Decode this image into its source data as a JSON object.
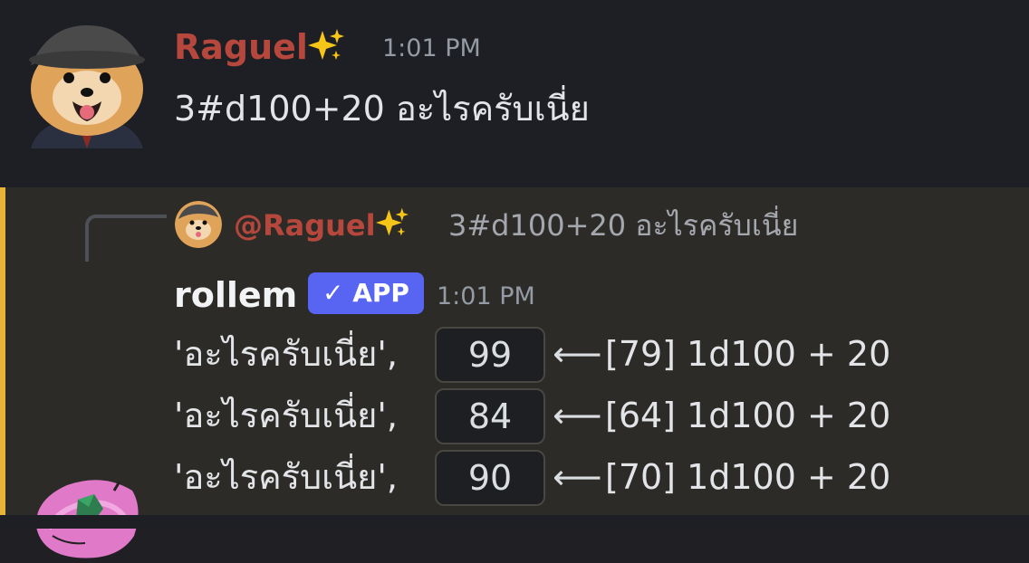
{
  "message1": {
    "author": "Raguel",
    "time": "1:01 PM",
    "content": "3#d100+20 อะไรครับเนี่ย",
    "name_color": "#b5473c"
  },
  "message2": {
    "reply": {
      "mention": "@Raguel",
      "text": "3#d100+20 อะไรครับเนี่ย"
    },
    "author": "rollem",
    "badge": "✓ APP",
    "time": "1:01 PM",
    "accent_color": "#e8b437",
    "rolls": [
      {
        "label": "'อะไรครับเนี่ย',",
        "result": "99",
        "arrow": "⟵",
        "detail": "[79] 1d100 + 20"
      },
      {
        "label": "'อะไรครับเนี่ย',",
        "result": "84",
        "arrow": "⟵",
        "detail": "[64] 1d100 + 20"
      },
      {
        "label": "'อะไรครับเนี่ย',",
        "result": "90",
        "arrow": "⟵",
        "detail": "[70] 1d100 + 20"
      }
    ]
  },
  "icons": {
    "sparkle": "sparkles-icon",
    "avatar1": "pomeranian-avatar",
    "avatar2": "rollem-bot-avatar"
  }
}
